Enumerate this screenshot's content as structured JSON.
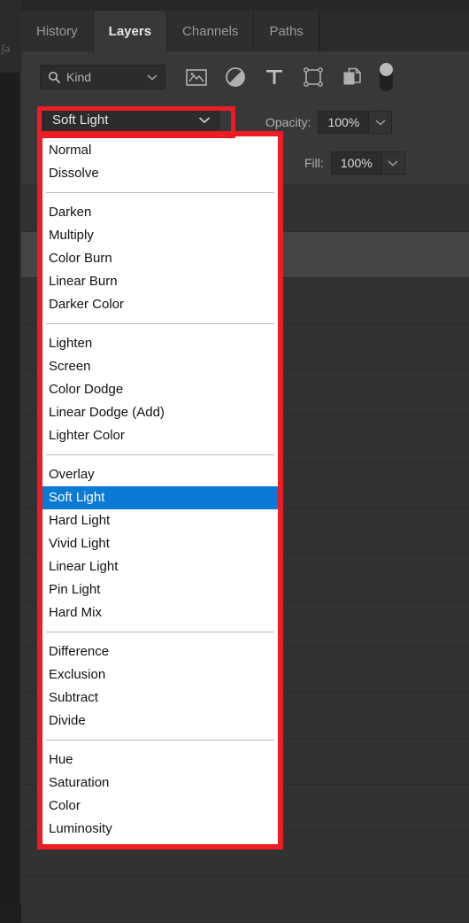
{
  "colors": {
    "panel_bg": "#323232",
    "tabbar_bg": "#272727",
    "active_tab_bg": "#383838",
    "highlight_red": "#ee1c24",
    "selection_blue": "#0b7ad4",
    "popup_bg": "#ffffff",
    "text_light": "#e6e6e6",
    "text_dim": "#9a9a9a"
  },
  "left_strip": {
    "glyph": "ʃə"
  },
  "tabs": [
    {
      "label": "History",
      "active": false
    },
    {
      "label": "Layers",
      "active": true
    },
    {
      "label": "Channels",
      "active": false
    },
    {
      "label": "Paths",
      "active": false
    }
  ],
  "filter_bar": {
    "search_icon": "search-icon",
    "kind_label": "Kind",
    "kind_chevron": "chevron-down-icon",
    "icons": [
      {
        "name": "pixel-layer-filter-icon"
      },
      {
        "name": "adjustment-layer-filter-icon"
      },
      {
        "name": "type-layer-filter-icon"
      },
      {
        "name": "shape-layer-filter-icon"
      },
      {
        "name": "smart-object-filter-icon"
      }
    ],
    "toggle": {
      "name": "filter-enable-toggle",
      "state": "on"
    }
  },
  "blend_row": {
    "selected_mode": "Soft Light",
    "chevron": "chevron-down-icon",
    "opacity_label": "Opacity:",
    "opacity_value": "100%",
    "opacity_chevron": "chevron-down-icon"
  },
  "fill_row": {
    "fill_label": "Fill:",
    "fill_value": "100%",
    "fill_chevron": "chevron-down-icon"
  },
  "blend_dropdown": {
    "selected": "Soft Light",
    "groups": [
      {
        "items": [
          "Normal",
          "Dissolve"
        ]
      },
      {
        "items": [
          "Darken",
          "Multiply",
          "Color Burn",
          "Linear Burn",
          "Darker Color"
        ]
      },
      {
        "items": [
          "Lighten",
          "Screen",
          "Color Dodge",
          "Linear Dodge (Add)",
          "Lighter Color"
        ]
      },
      {
        "items": [
          "Overlay",
          "Soft Light",
          "Hard Light",
          "Vivid Light",
          "Linear Light",
          "Pin Light",
          "Hard Mix"
        ]
      },
      {
        "items": [
          "Difference",
          "Exclusion",
          "Subtract",
          "Divide"
        ]
      },
      {
        "items": [
          "Hue",
          "Saturation",
          "Color",
          "Luminosity"
        ]
      }
    ]
  },
  "layer_rows": [
    {
      "state": "normal"
    },
    {
      "state": "selected"
    },
    {
      "state": "normal"
    },
    {
      "state": "normal"
    },
    {
      "state": "normal"
    },
    {
      "state": "normal"
    },
    {
      "state": "normal"
    },
    {
      "state": "normal"
    },
    {
      "state": "normal"
    },
    {
      "state": "normal"
    },
    {
      "state": "normal"
    },
    {
      "state": "normal"
    },
    {
      "state": "normal"
    },
    {
      "state": "normal"
    },
    {
      "state": "normal"
    },
    {
      "state": "normal"
    }
  ]
}
